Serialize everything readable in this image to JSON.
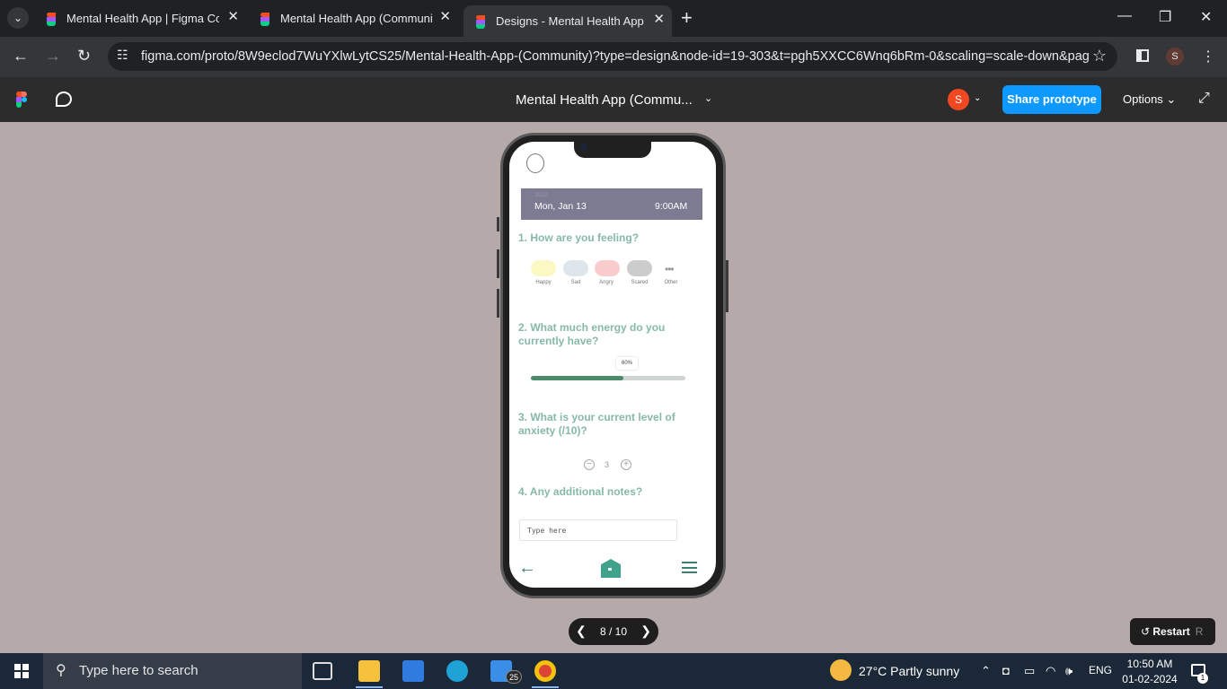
{
  "browser": {
    "tabs": [
      {
        "title": "Mental Health App | Figma Community"
      },
      {
        "title": "Mental Health App (Community)"
      },
      {
        "title": "Designs - Mental Health App (Community)"
      }
    ],
    "url": "figma.com/proto/8W9eclod7WuYXlwLytCS25/Mental-Health-App-(Community)?type=design&node-id=19-303&t=pgh5XXCC6Wnq6bRm-0&scaling=scale-down&page...",
    "profile_initial": "S"
  },
  "figma": {
    "doc_title": "Mental Health App (Commu...",
    "avatar_initial": "S",
    "share_label": "Share prototype",
    "options_label": "Options"
  },
  "app": {
    "date": {
      "year": "2022",
      "day": "Mon, Jan 13",
      "time": "9:00AM"
    },
    "q1": "1. How are you feeling?",
    "moods": [
      {
        "label": "Happy",
        "color": "#fbf8c4"
      },
      {
        "label": "Sad",
        "color": "#dee6ec"
      },
      {
        "label": "Angry",
        "color": "#f9cdcd"
      },
      {
        "label": "Scared",
        "color": "#cccccc"
      },
      {
        "label": "Other",
        "color": "#ffffff"
      }
    ],
    "q2": "2. What much energy do you currently have?",
    "energy": {
      "value": 0.6,
      "label": "60%"
    },
    "q3": "3. What is your current level of anxiety (/10)?",
    "anxiety": "3",
    "q4": "4. Any additional notes?",
    "notes_placeholder": "Type here",
    "accent": "#86b9a8"
  },
  "pager": {
    "text": "8 / 10"
  },
  "restart": {
    "label": "Restart",
    "key": "R"
  },
  "taskbar": {
    "search_placeholder": "Type here to search",
    "mail_badge": "25",
    "weather": "27°C  Partly sunny",
    "lang": "ENG",
    "time": "10:50 AM",
    "date": "01-02-2024",
    "notif_count": "1"
  }
}
